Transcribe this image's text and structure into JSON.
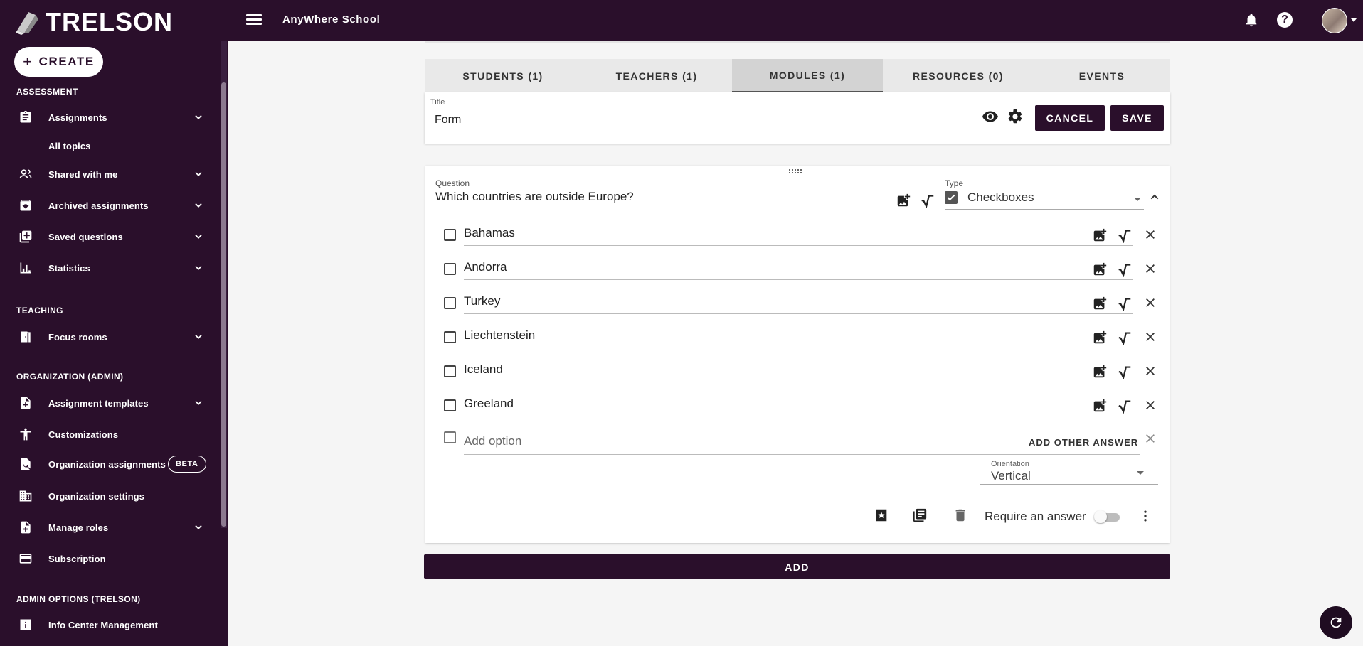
{
  "app": {
    "logo_text": "TRELSON",
    "school_name": "AnyWhere School"
  },
  "sidebar": {
    "create_label": "CREATE",
    "sections": {
      "assessment": "ASSESSMENT",
      "teaching": "TEACHING",
      "organization": "ORGANIZATION (ADMIN)",
      "admin_options": "ADMIN OPTIONS (TRELSON)"
    },
    "items": [
      {
        "label": "Assignments",
        "icon": "clipboard-icon"
      },
      {
        "label": "All topics",
        "icon": ""
      },
      {
        "label": "Shared with me",
        "icon": "people-icon"
      },
      {
        "label": "Archived assignments",
        "icon": "archive-icon"
      },
      {
        "label": "Saved questions",
        "icon": "add-box-icon"
      },
      {
        "label": "Statistics",
        "icon": "bar-chart-icon"
      },
      {
        "label": "Focus rooms",
        "icon": "door-icon"
      },
      {
        "label": "Assignment templates",
        "icon": "note-add-icon"
      },
      {
        "label": "Customizations",
        "icon": "accessibility-icon"
      },
      {
        "label": "Organization assignments",
        "icon": "find-in-page-icon"
      },
      {
        "label": "Organization settings",
        "icon": "domain-icon"
      },
      {
        "label": "Manage roles",
        "icon": "note-add-icon"
      },
      {
        "label": "Subscription",
        "icon": "credit-card-icon"
      },
      {
        "label": "Info Center Management",
        "icon": "info-icon"
      }
    ],
    "beta_label": "BETA"
  },
  "tabs": [
    {
      "label": "STUDENTS (1)",
      "active": false
    },
    {
      "label": "TEACHERS (1)",
      "active": false
    },
    {
      "label": "MODULES (1)",
      "active": true
    },
    {
      "label": "RESOURCES (0)",
      "active": false
    },
    {
      "label": "EVENTS",
      "active": false
    }
  ],
  "form": {
    "title_label": "Title",
    "title_value": "Form",
    "cancel_label": "CANCEL",
    "save_label": "SAVE"
  },
  "question": {
    "question_label": "Question",
    "question_text": "Which countries are outside Europe?",
    "type_label": "Type",
    "type_value": "Checkboxes",
    "options": [
      "Bahamas",
      "Andorra",
      "Turkey",
      "Liechtenstein",
      "Iceland",
      "Greeland"
    ],
    "add_option_placeholder": "Add option",
    "add_other_label": "ADD OTHER ANSWER",
    "orientation_label": "Orientation",
    "orientation_value": "Vertical",
    "require_label": "Require an answer",
    "require_on": false
  },
  "add_label": "ADD",
  "colors": {
    "brand": "#2a0f2b",
    "background": "#f5f5f5"
  }
}
